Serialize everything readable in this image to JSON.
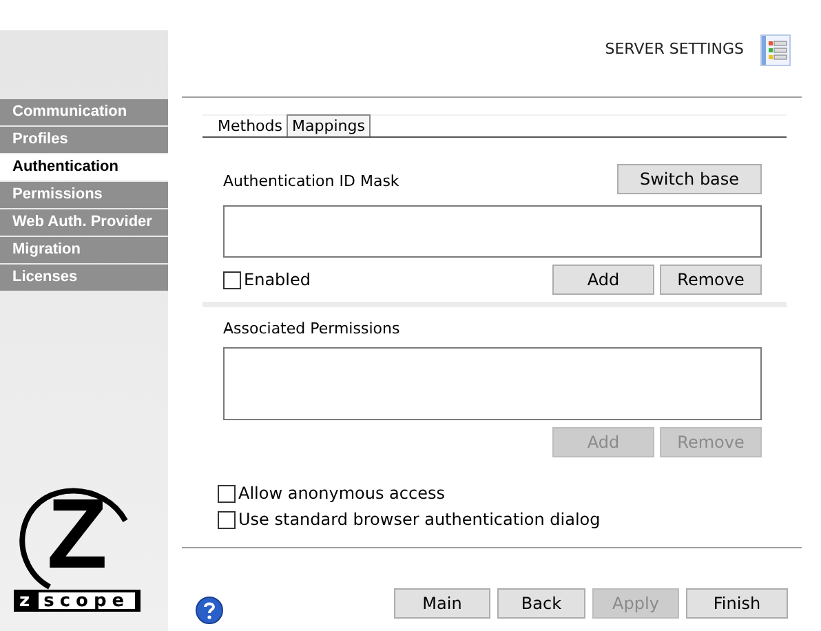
{
  "sidebar": {
    "items": [
      {
        "label": "Communication",
        "selected": false
      },
      {
        "label": "Profiles",
        "selected": false
      },
      {
        "label": "Authentication",
        "selected": true
      },
      {
        "label": "Permissions",
        "selected": false
      },
      {
        "label": "Web Auth. Provider",
        "selected": false
      },
      {
        "label": "Migration",
        "selected": false
      },
      {
        "label": "Licenses",
        "selected": false
      }
    ],
    "logo": {
      "mark": "Z",
      "prefix": "z",
      "word": "scope"
    }
  },
  "header": {
    "title": "SERVER SETTINGS"
  },
  "tabs": [
    {
      "label": "Methods",
      "selected": false
    },
    {
      "label": "Mappings",
      "selected": true
    }
  ],
  "mask": {
    "label": "Authentication ID Mask",
    "switch_button": "Switch base",
    "enabled": {
      "label": "Enabled",
      "checked": false
    },
    "buttons": [
      {
        "label": "Add",
        "disabled": false
      },
      {
        "label": "Remove",
        "disabled": false
      }
    ]
  },
  "permissions": {
    "label": "Associated Permissions",
    "buttons": [
      {
        "label": "Add",
        "disabled": true
      },
      {
        "label": "Remove",
        "disabled": true
      }
    ]
  },
  "options": [
    {
      "label": "Allow anonymous access",
      "checked": false
    },
    {
      "label": "Use standard browser authentication dialog",
      "checked": false
    }
  ],
  "footer_buttons": [
    {
      "label": "Main",
      "disabled": false
    },
    {
      "label": "Back",
      "disabled": false
    },
    {
      "label": "Apply",
      "disabled": true
    },
    {
      "label": "Finish",
      "disabled": false
    }
  ]
}
